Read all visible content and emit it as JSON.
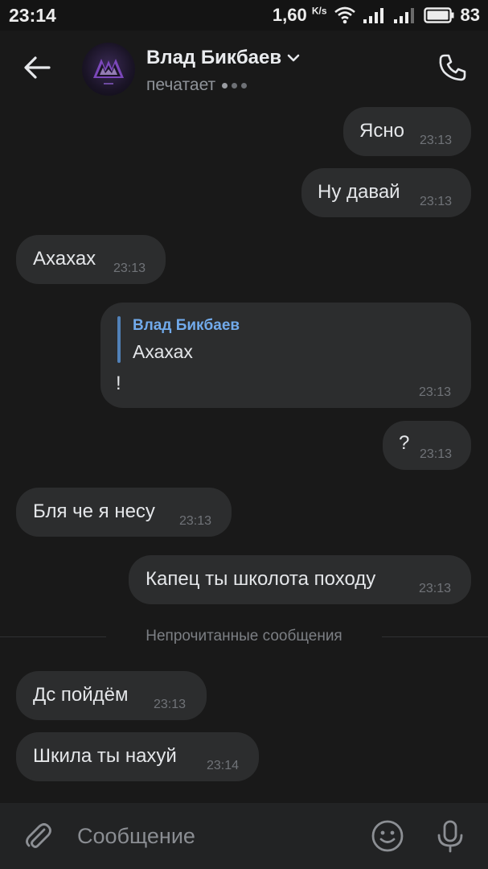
{
  "status_bar": {
    "time": "23:14",
    "speed_value": "1,60",
    "speed_unit": "K/s",
    "battery_percent": "83",
    "icons": [
      "wifi-icon",
      "signal-icon",
      "signal-icon",
      "battery-icon"
    ]
  },
  "header": {
    "back_icon": "arrow-left-icon",
    "contact_name": "Влад Бикбаев",
    "status": "печатает",
    "call_icon": "phone-icon"
  },
  "messages": [
    {
      "direction": "outgoing",
      "text": "Ясно",
      "time": "23:13"
    },
    {
      "direction": "outgoing",
      "text": "Ну давай",
      "time": "23:13"
    },
    {
      "direction": "incoming",
      "text": "Ахахах",
      "time": "23:13"
    },
    {
      "direction": "outgoing",
      "reply_author": "Влад Бикбаев",
      "reply_text": "Ахахах",
      "text": "!",
      "time": "23:13"
    },
    {
      "direction": "outgoing",
      "text": "?",
      "time": "23:13"
    },
    {
      "direction": "incoming",
      "text": "Бля че я несу",
      "time": "23:13"
    },
    {
      "direction": "outgoing",
      "text": "Капец ты школота походу",
      "time": "23:13"
    },
    {
      "direction": "incoming",
      "text": "Дс пойдём",
      "time": "23:13"
    },
    {
      "direction": "incoming",
      "text": "Шкила ты нахуй",
      "time": "23:14"
    }
  ],
  "unread_divider": "Непрочитанные сообщения",
  "composer": {
    "placeholder": "Сообщение",
    "attach_icon": "paperclip-icon",
    "emoji_icon": "emoji-icon",
    "mic_icon": "microphone-icon"
  },
  "colors": {
    "background": "#191919",
    "bubble": "#2c2d2e",
    "reply_accent": "#5181b8",
    "reply_author": "#71aaeb"
  }
}
